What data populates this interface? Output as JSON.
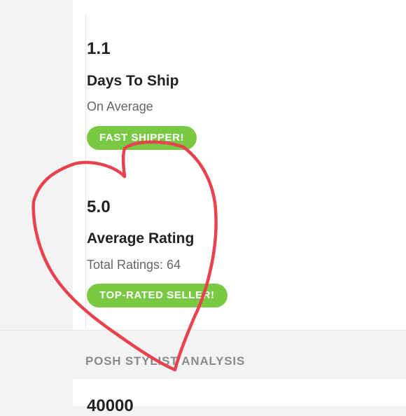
{
  "shipping": {
    "value": "1.1",
    "label": "Days To Ship",
    "sub": "On Average",
    "badge": "FAST SHIPPER!"
  },
  "rating": {
    "value": "5.0",
    "label": "Average Rating",
    "sub": "Total Ratings: 64",
    "badge": "TOP-RATED SELLER!"
  },
  "section": {
    "title": "POSH STYLIST ANALYSIS",
    "partial_value": "40000"
  },
  "colors": {
    "badge_green": "#7ac943",
    "annotation_red": "#e8424f",
    "background": "#f3f3f3"
  },
  "annotation": {
    "shape": "hand-drawn-heart"
  }
}
